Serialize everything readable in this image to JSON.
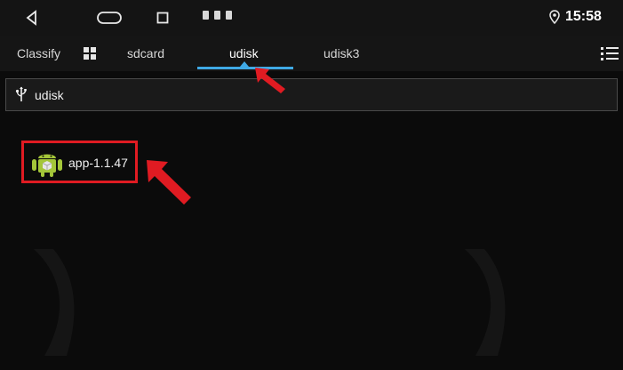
{
  "status_bar": {
    "time": "15:58"
  },
  "tabs": [
    {
      "label": "Classify"
    },
    {
      "label": "sdcard"
    },
    {
      "label": "udisk",
      "selected": true
    },
    {
      "label": "udisk3"
    }
  ],
  "path": {
    "label": "udisk"
  },
  "files": [
    {
      "name": "app-1.1.47"
    }
  ],
  "colors": {
    "accent": "#3fa9e6",
    "highlight_box": "#e01b22",
    "background": "#0b0b0b"
  }
}
